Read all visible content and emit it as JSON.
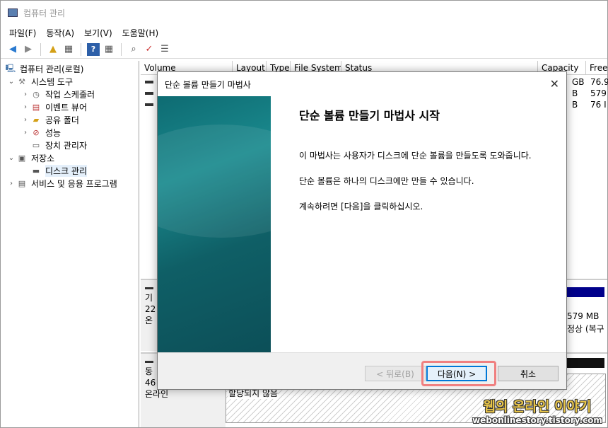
{
  "window": {
    "title": "컴퓨터 관리"
  },
  "menu": [
    "파일(F)",
    "동작(A)",
    "보기(V)",
    "도움말(H)"
  ],
  "tree": {
    "root": "컴퓨터 관리(로컬)",
    "system_tools": "시스템 도구",
    "task_scheduler": "작업 스케줄러",
    "event_viewer": "이벤트 뷰어",
    "shared_folders": "공유 폴더",
    "performance": "성능",
    "device_manager": "장치 관리자",
    "storage": "저장소",
    "disk_management": "디스크 관리",
    "services": "서비스 및 응용 프로그램"
  },
  "volume_table": {
    "headers": [
      "Volume",
      "Layout",
      "Type",
      "File System",
      "Status",
      "Capacity",
      "Free"
    ],
    "rows": [
      {
        "capacity": "GB",
        "free": "76.9"
      },
      {
        "capacity": "B",
        "free": "579"
      },
      {
        "capacity": "B",
        "free": "76 I"
      }
    ]
  },
  "disk0": {
    "line1": "기",
    "line2": "22",
    "line3": "온",
    "right1": "579 MB",
    "right2": "정상 (복구"
  },
  "disk1": {
    "line1": "동",
    "line2": "46",
    "line3": "온라인",
    "unallocated": "할당되지 않음"
  },
  "dialog": {
    "title": "단순 볼륨 만들기 마법사",
    "heading": "단순 볼륨 만들기 마법사 시작",
    "para1": "이 마법사는 사용자가 디스크에 단순 볼륨을 만들도록 도와줍니다.",
    "para2": "단순 볼륨은 하나의 디스크에만 만들 수 있습니다.",
    "para3": "계속하려면 [다음]을 클릭하십시오.",
    "back_button": "< 뒤로(B)",
    "next_button": "다음(N) >",
    "cancel_button": "취소"
  },
  "watermark": {
    "line1": "웹의 온라인 이야기",
    "line2": "webonlinestory.tistory.com"
  },
  "colors": {
    "accent": "#0078d7",
    "highlight": "#f08080",
    "banner": "#0e6b72",
    "bar": "#00008b"
  }
}
